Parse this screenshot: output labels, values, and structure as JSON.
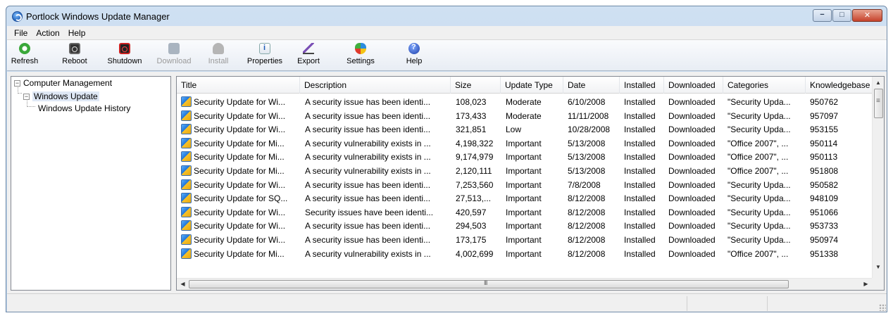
{
  "window": {
    "title": "Portlock Windows Update Manager",
    "minimize": "−",
    "maximize": "□",
    "close": "✕"
  },
  "menu": [
    "File",
    "Action",
    "Help"
  ],
  "toolbar": [
    {
      "label": "Refresh",
      "icon": "refresh-icon",
      "enabled": true
    },
    {
      "label": "Reboot",
      "icon": "reboot-icon",
      "enabled": true
    },
    {
      "label": "Shutdown",
      "icon": "shutdown-icon",
      "enabled": true
    },
    {
      "label": "Download",
      "icon": "download-icon",
      "enabled": false
    },
    {
      "label": "Install",
      "icon": "install-icon",
      "enabled": false
    },
    {
      "label": "Properties",
      "icon": "properties-icon",
      "enabled": true
    },
    {
      "label": "Export",
      "icon": "export-icon",
      "enabled": true
    },
    {
      "label": "Settings",
      "icon": "settings-icon",
      "enabled": true
    },
    {
      "label": "Help",
      "icon": "help-icon",
      "enabled": true
    }
  ],
  "tree": {
    "root": "Computer Management",
    "child": "Windows Update",
    "grandchild": "Windows Update History",
    "expander_expanded": "−"
  },
  "grid": {
    "columns": [
      "Title",
      "Description",
      "Size",
      "Update Type",
      "Date",
      "Installed",
      "Downloaded",
      "Categories",
      "Knowledgebase"
    ],
    "rows": [
      [
        "Security Update for Wi...",
        "A security issue has been identi...",
        "108,023",
        "Moderate",
        "6/10/2008",
        "Installed",
        "Downloaded",
        "\"Security Upda...",
        "950762"
      ],
      [
        "Security Update for Wi...",
        "A security issue has been identi...",
        "173,433",
        "Moderate",
        "11/11/2008",
        "Installed",
        "Downloaded",
        "\"Security Upda...",
        "957097"
      ],
      [
        "Security Update for Wi...",
        "A security issue has been identi...",
        "321,851",
        "Low",
        "10/28/2008",
        "Installed",
        "Downloaded",
        "\"Security Upda...",
        "953155"
      ],
      [
        "Security Update for Mi...",
        "A security vulnerability exists in ...",
        "4,198,322",
        "Important",
        "5/13/2008",
        "Installed",
        "Downloaded",
        "\"Office 2007\", ...",
        "950114"
      ],
      [
        "Security Update for Mi...",
        "A security vulnerability exists in ...",
        "9,174,979",
        "Important",
        "5/13/2008",
        "Installed",
        "Downloaded",
        "\"Office 2007\", ...",
        "950113"
      ],
      [
        "Security Update for Mi...",
        "A security vulnerability exists in ...",
        "2,120,111",
        "Important",
        "5/13/2008",
        "Installed",
        "Downloaded",
        "\"Office 2007\", ...",
        "951808"
      ],
      [
        "Security Update for Wi...",
        "A security issue has been identi...",
        "7,253,560",
        "Important",
        "7/8/2008",
        "Installed",
        "Downloaded",
        "\"Security Upda...",
        "950582"
      ],
      [
        "Security Update for SQ...",
        "A security issue has been identi...",
        "27,513,...",
        "Important",
        "8/12/2008",
        "Installed",
        "Downloaded",
        "\"Security Upda...",
        "948109"
      ],
      [
        "Security Update for Wi...",
        "Security issues have been identi...",
        "420,597",
        "Important",
        "8/12/2008",
        "Installed",
        "Downloaded",
        "\"Security Upda...",
        "951066"
      ],
      [
        "Security Update for Wi...",
        "A security issue has been identi...",
        "294,503",
        "Important",
        "8/12/2008",
        "Installed",
        "Downloaded",
        "\"Security Upda...",
        "953733"
      ],
      [
        "Security Update for Wi...",
        "A security issue has been identi...",
        "173,175",
        "Important",
        "8/12/2008",
        "Installed",
        "Downloaded",
        "\"Security Upda...",
        "950974"
      ],
      [
        "Security Update for Mi...",
        "A security vulnerability exists in ...",
        "4,002,699",
        "Important",
        "8/12/2008",
        "Installed",
        "Downloaded",
        "\"Office 2007\", ...",
        "951338"
      ]
    ],
    "scroll": {
      "up": "▲",
      "down": "▼",
      "left": "◀",
      "right": "▶"
    }
  },
  "colors": {
    "titlebar": "#c4d8ef",
    "selection": "#dfe8f5",
    "disabled_text": "#9a9a9a"
  }
}
